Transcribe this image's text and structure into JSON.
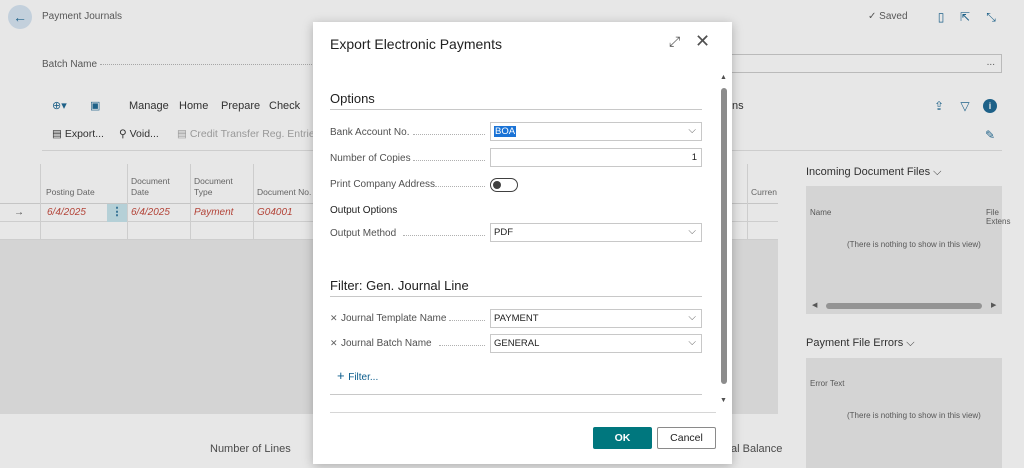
{
  "page": {
    "title": "Payment Journals",
    "saved": "Saved",
    "batch_label": "Batch Name",
    "batch_more": "..."
  },
  "actions": {
    "manage": "Manage",
    "home": "Home",
    "prepare": "Prepare",
    "check": "Check",
    "export": "Export...",
    "void": "Void...",
    "credit_transfer": "Credit Transfer Reg. Entries",
    "ns_suffix": "ns"
  },
  "grid": {
    "headers": [
      "Posting Date",
      "Document Date",
      "Document Type",
      "Document No.",
      "Curren"
    ],
    "row": {
      "posting_date": "6/4/2025",
      "document_date": "6/4/2025",
      "document_type": "Payment",
      "document_no": "G04001"
    },
    "row_menu": "⋮",
    "row_arrow": "→"
  },
  "footer": {
    "number_of_lines": "Number of Lines",
    "total_balance": "al Balance"
  },
  "factbox": {
    "incoming_title": "Incoming Document Files",
    "col_name": "Name",
    "col_file_ext": "File Extens",
    "empty1": "(There is nothing to show in this view)",
    "errors_title": "Payment File Errors",
    "error_text": "Error Text",
    "empty2": "(There is nothing to show in this view)"
  },
  "dialog": {
    "title": "Export Electronic Payments",
    "options_section": "Options",
    "bank_account_label": "Bank Account No.",
    "bank_account_value": "BOA",
    "copies_label": "Number of Copies",
    "copies_value": "1",
    "print_company_label": "Print Company Address",
    "print_company_on": false,
    "output_options": "Output Options",
    "output_method_label": "Output Method",
    "output_method_value": "PDF",
    "filter_section": "Filter: Gen. Journal Line",
    "journal_template_label": "Journal Template Name",
    "journal_template_value": "PAYMENT",
    "journal_batch_label": "Journal Batch Name",
    "journal_batch_value": "GENERAL",
    "add_filter": "Filter...",
    "ok": "OK",
    "cancel": "Cancel"
  },
  "icons": {
    "back": "back-arrow-icon",
    "bookmark": "bookmark-icon",
    "open_new": "open-in-new-icon",
    "collapse": "collapse-icon",
    "share": "share-icon",
    "filter": "filter-icon",
    "info": "info-icon",
    "expand": "expand-icon",
    "close": "close-icon"
  },
  "colors": {
    "accent": "#00777e",
    "link": "#0a5c8c",
    "row_value": "#c0392b",
    "selection": "#1a73d6"
  }
}
